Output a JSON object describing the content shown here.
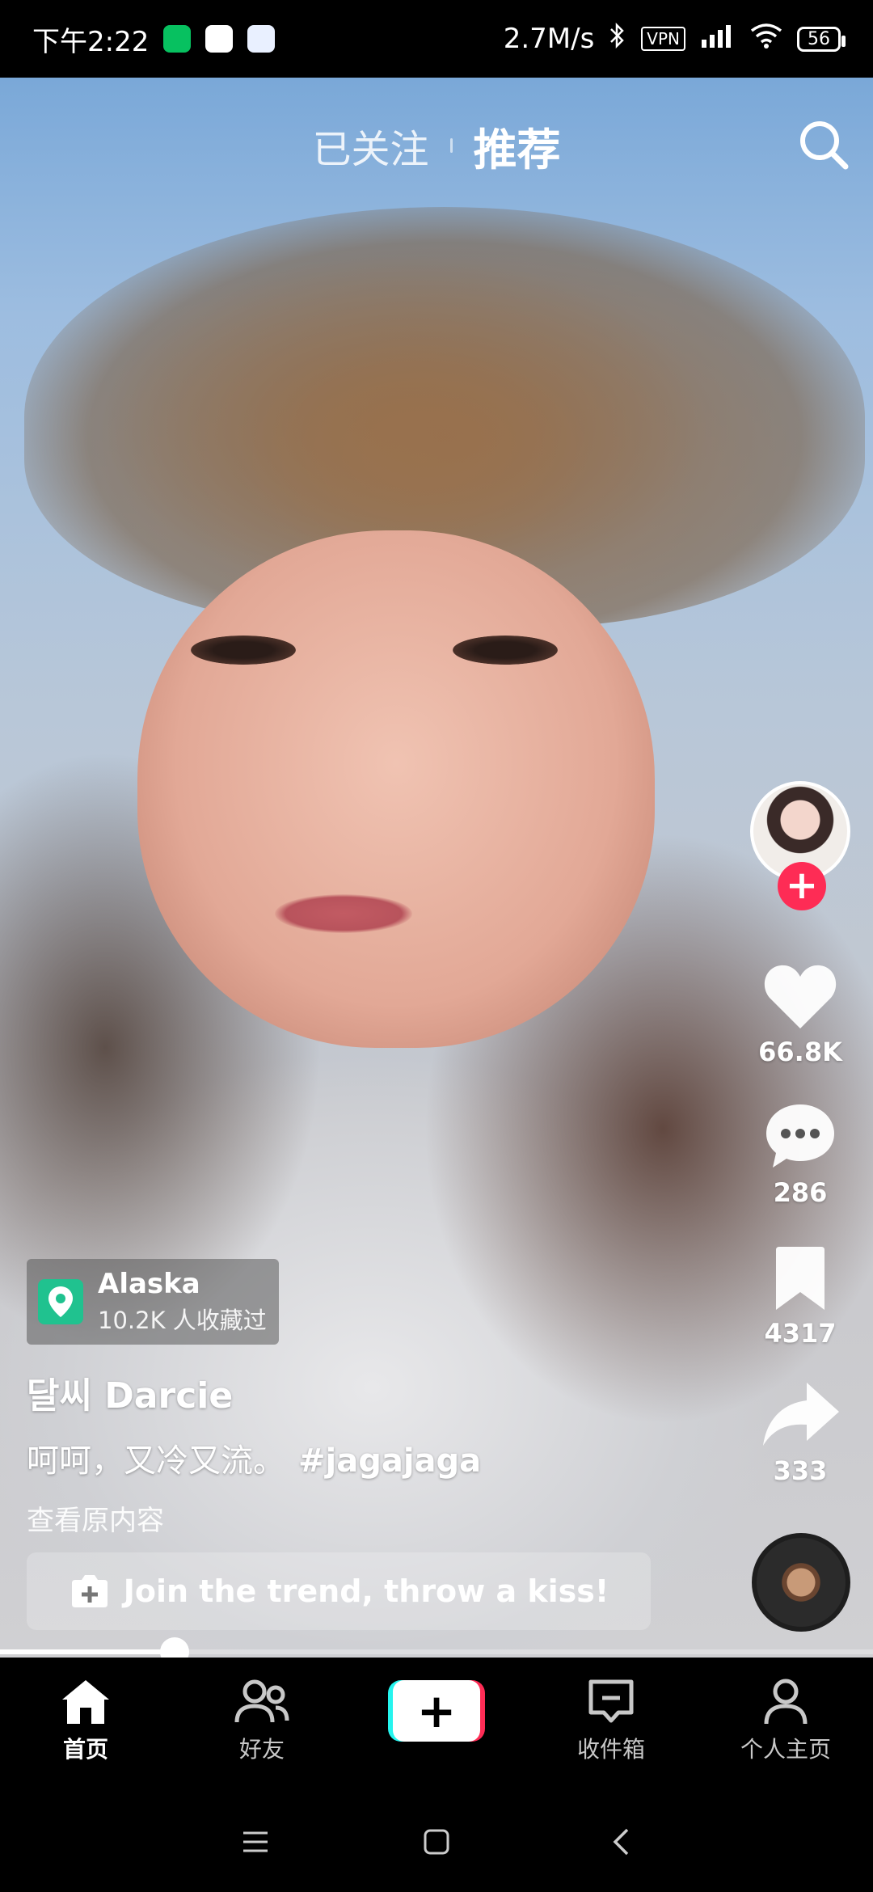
{
  "status_bar": {
    "time": "下午2:22",
    "net_speed": "2.7M/s",
    "vpn": "VPN",
    "battery": "56"
  },
  "top_tabs": {
    "following": "已关注",
    "recommended": "推荐"
  },
  "actions": {
    "likes": "66.8K",
    "comments": "286",
    "favorites": "4317",
    "shares": "333"
  },
  "location": {
    "name": "Alaska",
    "saved": "10.2K 人收藏过"
  },
  "post": {
    "author": "달씨 Darcie",
    "caption": "呵呵，又冷又流。",
    "hashtag": "#jagajaga",
    "view_original": "查看原内容"
  },
  "trend_button": {
    "label": "Join the trend, throw a kiss!"
  },
  "playback": {
    "progress": 0.2
  },
  "bottom_nav": {
    "home": "首页",
    "friends": "好友",
    "inbox": "收件箱",
    "profile": "个人主页"
  },
  "colors": {
    "accent_red": "#fe2c55",
    "accent_cyan": "#25f4ee",
    "location_green": "#20c28f"
  }
}
